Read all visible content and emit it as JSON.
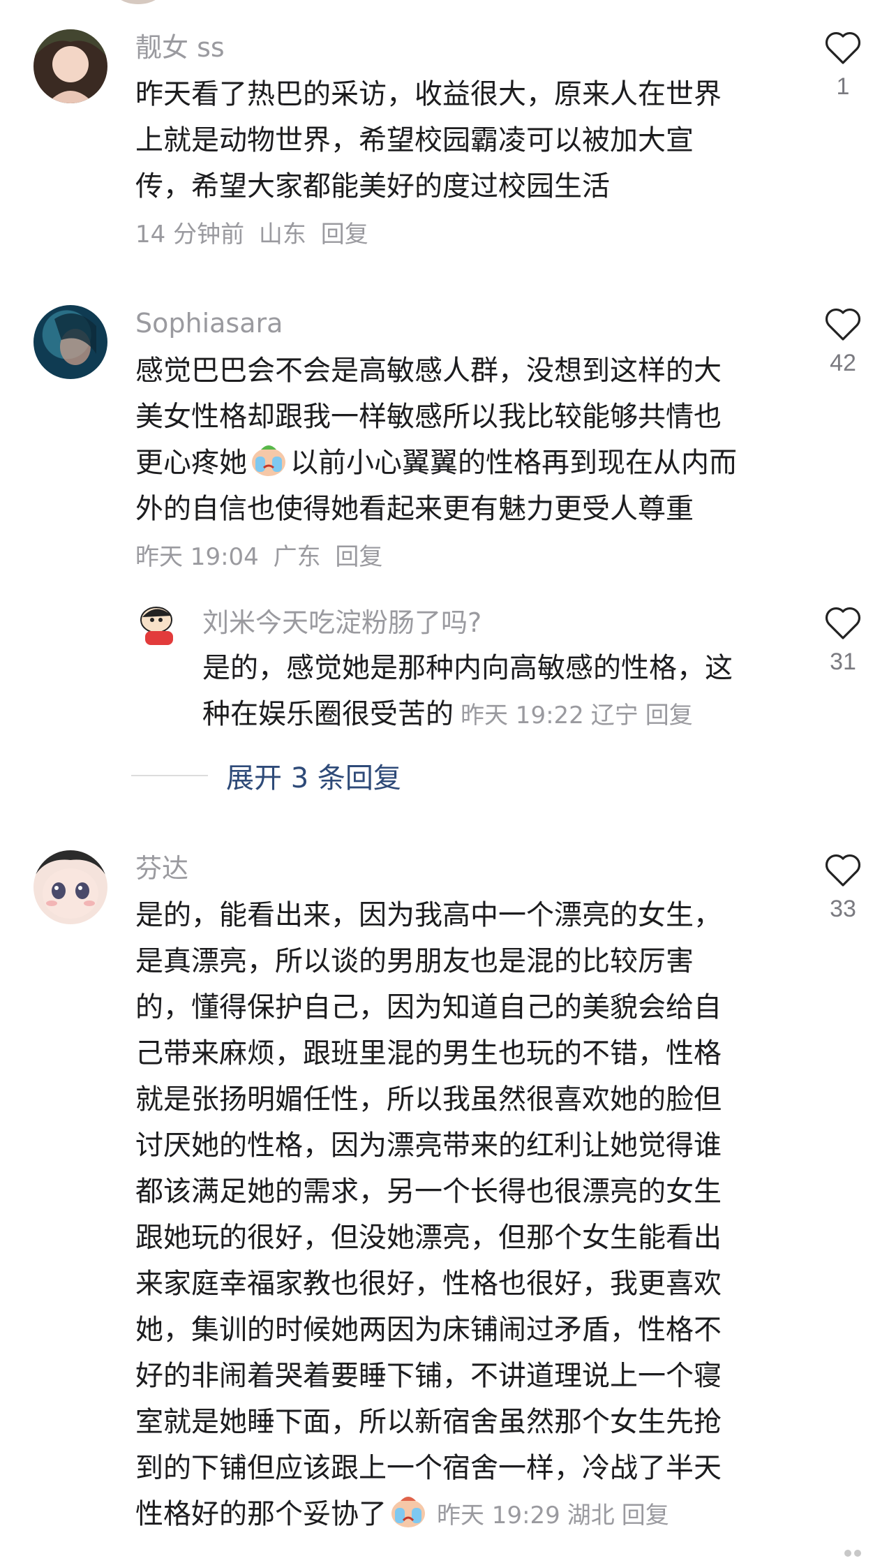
{
  "comments": [
    {
      "username": "靓女 ss",
      "lines": [
        "昨天看了热巴的采访，收益很大，原来人在世界",
        "上就是动物世界，希望校园霸凌可以被加大宣",
        "传，希望大家都能美好的度过校园生活"
      ],
      "time": "14 分钟前",
      "location": "山东",
      "reply_label": "回复",
      "likes": "1"
    },
    {
      "username": "Sophiasara",
      "lines": [
        "感觉巴巴会不会是高敏感人群，没想到这样的大",
        "美女性格却跟我一样敏感所以我比较能够共情也"
      ],
      "line3_a": "更心疼她",
      "line3_b": "以前小心翼翼的性格再到现在从内而",
      "line4": "外的自信也使得她看起来更有魅力更受人尊重",
      "time": "昨天 19:04",
      "location": "广东",
      "reply_label": "回复",
      "likes": "42"
    },
    {
      "username": "刘米今天吃淀粉肠了吗?",
      "line1": "是的，感觉她是那种内向高敏感的性格，这",
      "line2": "种在娱乐圈很受苦的",
      "time": "昨天 19:22",
      "location": "辽宁",
      "reply_label": "回复",
      "likes": "31"
    },
    {
      "username": "芬达",
      "lines": [
        "是的，能看出来，因为我高中一个漂亮的女生，",
        "是真漂亮，所以谈的男朋友也是混的比较厉害",
        "的，懂得保护自己，因为知道自己的美貌会给自",
        "己带来麻烦，跟班里混的男生也玩的不错，性格",
        "就是张扬明媚任性，所以我虽然很喜欢她的脸但",
        "讨厌她的性格，因为漂亮带来的红利让她觉得谁",
        "都该满足她的需求，另一个长得也很漂亮的女生",
        "跟她玩的很好，但没她漂亮，但那个女生能看出",
        "来家庭幸福家教也很好，性格也很好，我更喜欢",
        "她，集训的时候她两因为床铺闹过矛盾，性格不",
        "好的非闹着哭着要睡下铺，不讲道理说上一个寝",
        "室就是她睡下面，所以新宿舍虽然那个女生先抢",
        "到的下铺但应该跟上一个宿舍一样，冷战了半天"
      ],
      "last_line": "性格好的那个妥协了",
      "time": "昨天 19:29",
      "location": "湖北",
      "reply_label": "回复",
      "likes": "33"
    }
  ],
  "expand_replies": "展开 3 条回复",
  "icons": {
    "like": "heart-outline-icon",
    "emoji_crying": "crying-face-emoji-icon",
    "emoji_crying2": "crying-face-emoji-icon"
  }
}
